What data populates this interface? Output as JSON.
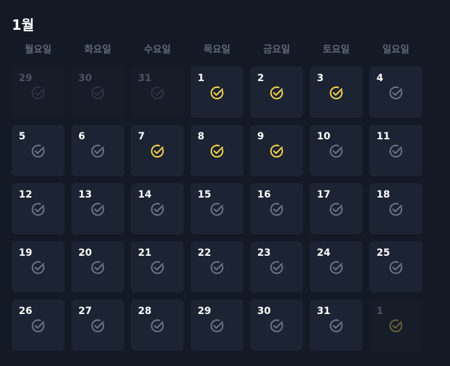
{
  "calendar": {
    "month_title": "1월",
    "weekdays": [
      "월요일",
      "화요일",
      "수요일",
      "목요일",
      "금요일",
      "토요일",
      "일요일"
    ],
    "colors": {
      "checked": "#f6d44a",
      "unchecked": "#6b7484",
      "cell_bg": "#1c2333",
      "page_bg": "#141a25"
    },
    "days": [
      {
        "label": "29",
        "current_month": false,
        "checked": false
      },
      {
        "label": "30",
        "current_month": false,
        "checked": false
      },
      {
        "label": "31",
        "current_month": false,
        "checked": false
      },
      {
        "label": "1",
        "current_month": true,
        "checked": true
      },
      {
        "label": "2",
        "current_month": true,
        "checked": true
      },
      {
        "label": "3",
        "current_month": true,
        "checked": true
      },
      {
        "label": "4",
        "current_month": true,
        "checked": false
      },
      {
        "label": "5",
        "current_month": true,
        "checked": false
      },
      {
        "label": "6",
        "current_month": true,
        "checked": false
      },
      {
        "label": "7",
        "current_month": true,
        "checked": true
      },
      {
        "label": "8",
        "current_month": true,
        "checked": true
      },
      {
        "label": "9",
        "current_month": true,
        "checked": true
      },
      {
        "label": "10",
        "current_month": true,
        "checked": false
      },
      {
        "label": "11",
        "current_month": true,
        "checked": false
      },
      {
        "label": "12",
        "current_month": true,
        "checked": false
      },
      {
        "label": "13",
        "current_month": true,
        "checked": false
      },
      {
        "label": "14",
        "current_month": true,
        "checked": false
      },
      {
        "label": "15",
        "current_month": true,
        "checked": false
      },
      {
        "label": "16",
        "current_month": true,
        "checked": false
      },
      {
        "label": "17",
        "current_month": true,
        "checked": false
      },
      {
        "label": "18",
        "current_month": true,
        "checked": false
      },
      {
        "label": "19",
        "current_month": true,
        "checked": false
      },
      {
        "label": "20",
        "current_month": true,
        "checked": false
      },
      {
        "label": "21",
        "current_month": true,
        "checked": false
      },
      {
        "label": "22",
        "current_month": true,
        "checked": false
      },
      {
        "label": "23",
        "current_month": true,
        "checked": false
      },
      {
        "label": "24",
        "current_month": true,
        "checked": false
      },
      {
        "label": "25",
        "current_month": true,
        "checked": false
      },
      {
        "label": "26",
        "current_month": true,
        "checked": false
      },
      {
        "label": "27",
        "current_month": true,
        "checked": false
      },
      {
        "label": "28",
        "current_month": true,
        "checked": false
      },
      {
        "label": "29",
        "current_month": true,
        "checked": false
      },
      {
        "label": "30",
        "current_month": true,
        "checked": false
      },
      {
        "label": "31",
        "current_month": true,
        "checked": false
      },
      {
        "label": "1",
        "current_month": false,
        "checked": true
      }
    ]
  }
}
